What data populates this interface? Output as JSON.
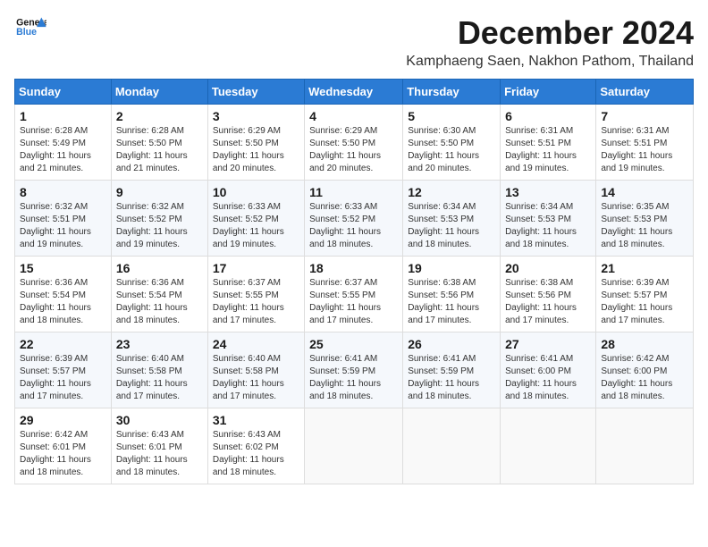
{
  "logo": {
    "line1": "General",
    "line2": "Blue"
  },
  "title": "December 2024",
  "location": "Kamphaeng Saen, Nakhon Pathom, Thailand",
  "weekdays": [
    "Sunday",
    "Monday",
    "Tuesday",
    "Wednesday",
    "Thursday",
    "Friday",
    "Saturday"
  ],
  "weeks": [
    [
      {
        "day": "1",
        "info": "Sunrise: 6:28 AM\nSunset: 5:49 PM\nDaylight: 11 hours\nand 21 minutes."
      },
      {
        "day": "2",
        "info": "Sunrise: 6:28 AM\nSunset: 5:50 PM\nDaylight: 11 hours\nand 21 minutes."
      },
      {
        "day": "3",
        "info": "Sunrise: 6:29 AM\nSunset: 5:50 PM\nDaylight: 11 hours\nand 20 minutes."
      },
      {
        "day": "4",
        "info": "Sunrise: 6:29 AM\nSunset: 5:50 PM\nDaylight: 11 hours\nand 20 minutes."
      },
      {
        "day": "5",
        "info": "Sunrise: 6:30 AM\nSunset: 5:50 PM\nDaylight: 11 hours\nand 20 minutes."
      },
      {
        "day": "6",
        "info": "Sunrise: 6:31 AM\nSunset: 5:51 PM\nDaylight: 11 hours\nand 19 minutes."
      },
      {
        "day": "7",
        "info": "Sunrise: 6:31 AM\nSunset: 5:51 PM\nDaylight: 11 hours\nand 19 minutes."
      }
    ],
    [
      {
        "day": "8",
        "info": "Sunrise: 6:32 AM\nSunset: 5:51 PM\nDaylight: 11 hours\nand 19 minutes."
      },
      {
        "day": "9",
        "info": "Sunrise: 6:32 AM\nSunset: 5:52 PM\nDaylight: 11 hours\nand 19 minutes."
      },
      {
        "day": "10",
        "info": "Sunrise: 6:33 AM\nSunset: 5:52 PM\nDaylight: 11 hours\nand 19 minutes."
      },
      {
        "day": "11",
        "info": "Sunrise: 6:33 AM\nSunset: 5:52 PM\nDaylight: 11 hours\nand 18 minutes."
      },
      {
        "day": "12",
        "info": "Sunrise: 6:34 AM\nSunset: 5:53 PM\nDaylight: 11 hours\nand 18 minutes."
      },
      {
        "day": "13",
        "info": "Sunrise: 6:34 AM\nSunset: 5:53 PM\nDaylight: 11 hours\nand 18 minutes."
      },
      {
        "day": "14",
        "info": "Sunrise: 6:35 AM\nSunset: 5:53 PM\nDaylight: 11 hours\nand 18 minutes."
      }
    ],
    [
      {
        "day": "15",
        "info": "Sunrise: 6:36 AM\nSunset: 5:54 PM\nDaylight: 11 hours\nand 18 minutes."
      },
      {
        "day": "16",
        "info": "Sunrise: 6:36 AM\nSunset: 5:54 PM\nDaylight: 11 hours\nand 18 minutes."
      },
      {
        "day": "17",
        "info": "Sunrise: 6:37 AM\nSunset: 5:55 PM\nDaylight: 11 hours\nand 17 minutes."
      },
      {
        "day": "18",
        "info": "Sunrise: 6:37 AM\nSunset: 5:55 PM\nDaylight: 11 hours\nand 17 minutes."
      },
      {
        "day": "19",
        "info": "Sunrise: 6:38 AM\nSunset: 5:56 PM\nDaylight: 11 hours\nand 17 minutes."
      },
      {
        "day": "20",
        "info": "Sunrise: 6:38 AM\nSunset: 5:56 PM\nDaylight: 11 hours\nand 17 minutes."
      },
      {
        "day": "21",
        "info": "Sunrise: 6:39 AM\nSunset: 5:57 PM\nDaylight: 11 hours\nand 17 minutes."
      }
    ],
    [
      {
        "day": "22",
        "info": "Sunrise: 6:39 AM\nSunset: 5:57 PM\nDaylight: 11 hours\nand 17 minutes."
      },
      {
        "day": "23",
        "info": "Sunrise: 6:40 AM\nSunset: 5:58 PM\nDaylight: 11 hours\nand 17 minutes."
      },
      {
        "day": "24",
        "info": "Sunrise: 6:40 AM\nSunset: 5:58 PM\nDaylight: 11 hours\nand 17 minutes."
      },
      {
        "day": "25",
        "info": "Sunrise: 6:41 AM\nSunset: 5:59 PM\nDaylight: 11 hours\nand 18 minutes."
      },
      {
        "day": "26",
        "info": "Sunrise: 6:41 AM\nSunset: 5:59 PM\nDaylight: 11 hours\nand 18 minutes."
      },
      {
        "day": "27",
        "info": "Sunrise: 6:41 AM\nSunset: 6:00 PM\nDaylight: 11 hours\nand 18 minutes."
      },
      {
        "day": "28",
        "info": "Sunrise: 6:42 AM\nSunset: 6:00 PM\nDaylight: 11 hours\nand 18 minutes."
      }
    ],
    [
      {
        "day": "29",
        "info": "Sunrise: 6:42 AM\nSunset: 6:01 PM\nDaylight: 11 hours\nand 18 minutes."
      },
      {
        "day": "30",
        "info": "Sunrise: 6:43 AM\nSunset: 6:01 PM\nDaylight: 11 hours\nand 18 minutes."
      },
      {
        "day": "31",
        "info": "Sunrise: 6:43 AM\nSunset: 6:02 PM\nDaylight: 11 hours\nand 18 minutes."
      },
      null,
      null,
      null,
      null
    ]
  ]
}
